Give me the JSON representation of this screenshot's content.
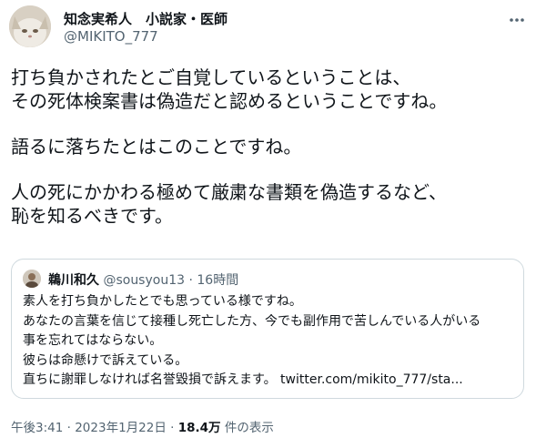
{
  "author": {
    "name": "知念実希人　小説家・医師",
    "handle": "@MIKITO_777"
  },
  "tweet": {
    "lines": [
      "打ち負かされたとご自覚しているということは、",
      "その死体検案書は偽造だと認めるということですね。",
      "語るに落ちたとはこのことですね。",
      "人の死にかかわる極めて厳粛な書類を偽造するなど、",
      "恥を知るべきです。"
    ]
  },
  "quoted_tweet": {
    "name": "鵜川和久",
    "handle": "@sousyou13",
    "separator": "·",
    "time": "16時間",
    "lines": [
      "素人を打ち負かしたとでも思っている様ですね。",
      "あなたの言葉を信じて接種し死亡した方、今でも副作用で苦しんでいる人がいる",
      "事を忘れてはならない。",
      "彼らは命懸けで訴えている。",
      "直ちに謝罪しなければ名誉毀損で訴えます。 twitter.com/mikito_777/sta..."
    ]
  },
  "meta": {
    "time": "午後3:41",
    "separator": "·",
    "date": "2023年1月22日",
    "views_count": "18.4万",
    "views_label": "件の表示"
  },
  "icons": {
    "more": "more-icon",
    "author_avatar": "avatar",
    "quoted_avatar": "avatar"
  }
}
